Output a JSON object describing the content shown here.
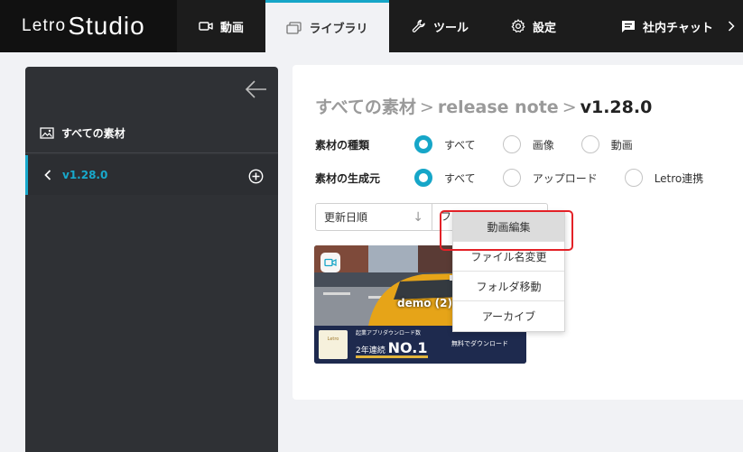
{
  "header": {
    "logo_part1": "Letro",
    "logo_part2": "Studio",
    "tabs": [
      {
        "label": "動画",
        "icon": "video-camera-icon"
      },
      {
        "label": "ライブラリ",
        "icon": "library-icon"
      },
      {
        "label": "ツール",
        "icon": "wrench-icon"
      },
      {
        "label": "設定",
        "icon": "gear-icon"
      },
      {
        "label": "社内チャット",
        "icon": "chat-icon"
      }
    ],
    "active_tab": "ライブラリ",
    "accent_color": "#16a6c8"
  },
  "sidebar": {
    "all_materials": "すべての素材",
    "folder": "v1.28.0",
    "back_icon": "arrow-left-icon",
    "add_icon": "plus-circle-icon"
  },
  "main": {
    "breadcrumb": [
      "すべての素材",
      "release note",
      "v1.28.0"
    ],
    "breadcrumb_separator": ">",
    "filter_type": {
      "label": "素材の種類",
      "options": [
        "すべて",
        "画像",
        "動画"
      ],
      "selected": "すべて"
    },
    "filter_source": {
      "label": "素材の生成元",
      "options": [
        "すべて",
        "アップロード",
        "Letro連携"
      ],
      "selected": "すべて"
    },
    "sort": {
      "value": "更新日順",
      "arrow": "↓"
    },
    "second_select": "フ",
    "card": {
      "title": "demo (2)",
      "banner_sub": "起業アプリダウンロード数",
      "banner_main": "2年連続",
      "banner_big": "NO.1",
      "banner_right": "無料でダウンロード",
      "thumb_text": "Letro"
    }
  },
  "context_menu": {
    "items": [
      "動画編集",
      "ファイル名変更",
      "フォルダ移動",
      "アーカイブ"
    ],
    "highlighted": "動画編集",
    "highlight_color": "#e32127"
  }
}
